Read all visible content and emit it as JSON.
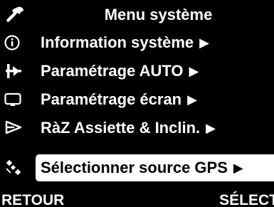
{
  "header": {
    "title": "Menu système",
    "icon": "wrench-icon"
  },
  "menu": {
    "items": [
      {
        "label": "Information système",
        "arrow": "▶",
        "icon": "info-icon"
      },
      {
        "label": "Paramétrage AUTO",
        "arrow": "▶",
        "icon": "autopilot-icon"
      },
      {
        "label": "Paramétrage écran",
        "arrow": "▶",
        "icon": "display-icon"
      },
      {
        "label": "RàZ Assiette & Inclin.",
        "arrow": "▶",
        "icon": "attitude-reset-icon"
      },
      {
        "label": "Sélectionner source GPS",
        "arrow": "▶",
        "icon": "satellite-icon",
        "selected": true
      }
    ]
  },
  "footer": {
    "left_label": "RETOUR",
    "right_label": "SÉLECT"
  },
  "colors": {
    "background": "#000000",
    "foreground": "#ffffff",
    "highlight": "#ffffff"
  }
}
